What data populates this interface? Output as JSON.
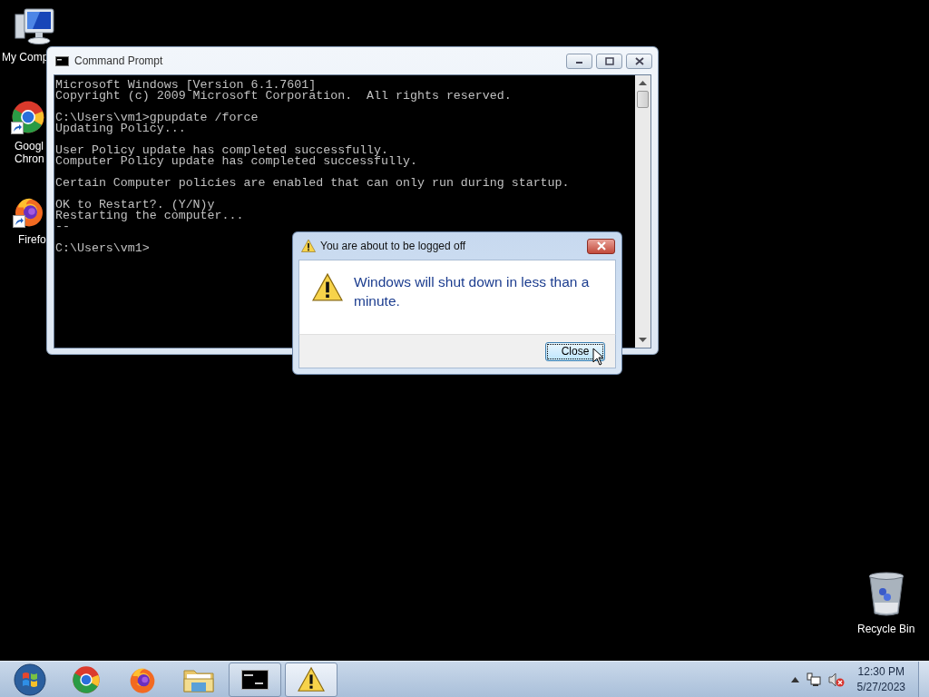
{
  "desktop_icons": [
    {
      "kind": "computer",
      "label_lines": [
        "My Comp"
      ]
    },
    {
      "kind": "chrome",
      "label_lines": [
        "Googl",
        "Chron"
      ]
    },
    {
      "kind": "firefox",
      "label_lines": [
        "Firefo"
      ]
    },
    {
      "kind": "recycle",
      "label_lines": [
        "Recycle Bin"
      ]
    }
  ],
  "console_window": {
    "title": "Command Prompt",
    "blocks": [
      [
        "Microsoft Windows [Version 6.1.7601]",
        "Copyright (c) 2009 Microsoft Corporation.  All rights reserved."
      ],
      [
        "C:\\Users\\vm1>gpupdate /force",
        "Updating Policy..."
      ],
      [
        "User Policy update has completed successfully.",
        "Computer Policy update has completed successfully."
      ],
      [
        "Certain Computer policies are enabled that can only run during startup."
      ],
      [
        "OK to Restart?. (Y/N)y",
        "Restarting the computer...",
        "--"
      ],
      [
        "C:\\Users\\vm1>"
      ]
    ]
  },
  "dialog": {
    "title": "You are about to be logged off",
    "message": "Windows will shut down in less than a minute.",
    "button": {
      "label": "Close",
      "focused": true
    }
  },
  "taskbar": {
    "items": [
      {
        "kind": "start",
        "running": false,
        "selected": false
      },
      {
        "kind": "chrome",
        "running": false,
        "selected": false
      },
      {
        "kind": "firefox",
        "running": false,
        "selected": false
      },
      {
        "kind": "explorer",
        "running": false,
        "selected": false
      },
      {
        "kind": "console",
        "running": true,
        "selected": false
      },
      {
        "kind": "warning",
        "running": true,
        "selected": true
      }
    ],
    "clock": {
      "time": "12:30 PM",
      "date": "5/27/2023"
    }
  }
}
